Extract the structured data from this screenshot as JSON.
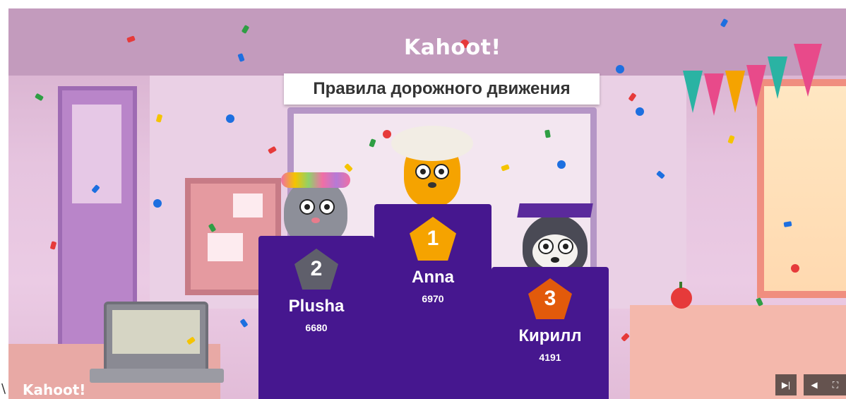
{
  "stray_char": "\\",
  "brand": {
    "logo_text": "Kahoot!",
    "corner_logo_text": "Kahoot!"
  },
  "quiz": {
    "title": "Правила дорожного движения"
  },
  "podium": [
    {
      "rank": "1",
      "name": "Anna",
      "score": "6970",
      "badge_color": "#f5a300",
      "avatar": "beaver-with-judge-wig"
    },
    {
      "rank": "2",
      "name": "Plusha",
      "score": "6680",
      "badge_color": "#5f5f6b",
      "avatar": "cat-with-flower-crown"
    },
    {
      "rank": "3",
      "name": "Кирилл",
      "score": "4191",
      "badge_color": "#e25a0b",
      "avatar": "raccoon-with-graduation-cap"
    }
  ],
  "controls": {
    "skip_icon": "skip-forward-icon",
    "skip_glyph": "▶|",
    "volume_icon": "volume-icon",
    "volume_glyph": "◀",
    "fullscreen_icon": "fullscreen-icon",
    "fullscreen_glyph": "⛶"
  },
  "colors": {
    "podium": "#46178f",
    "title_bg": "#ffffff"
  }
}
